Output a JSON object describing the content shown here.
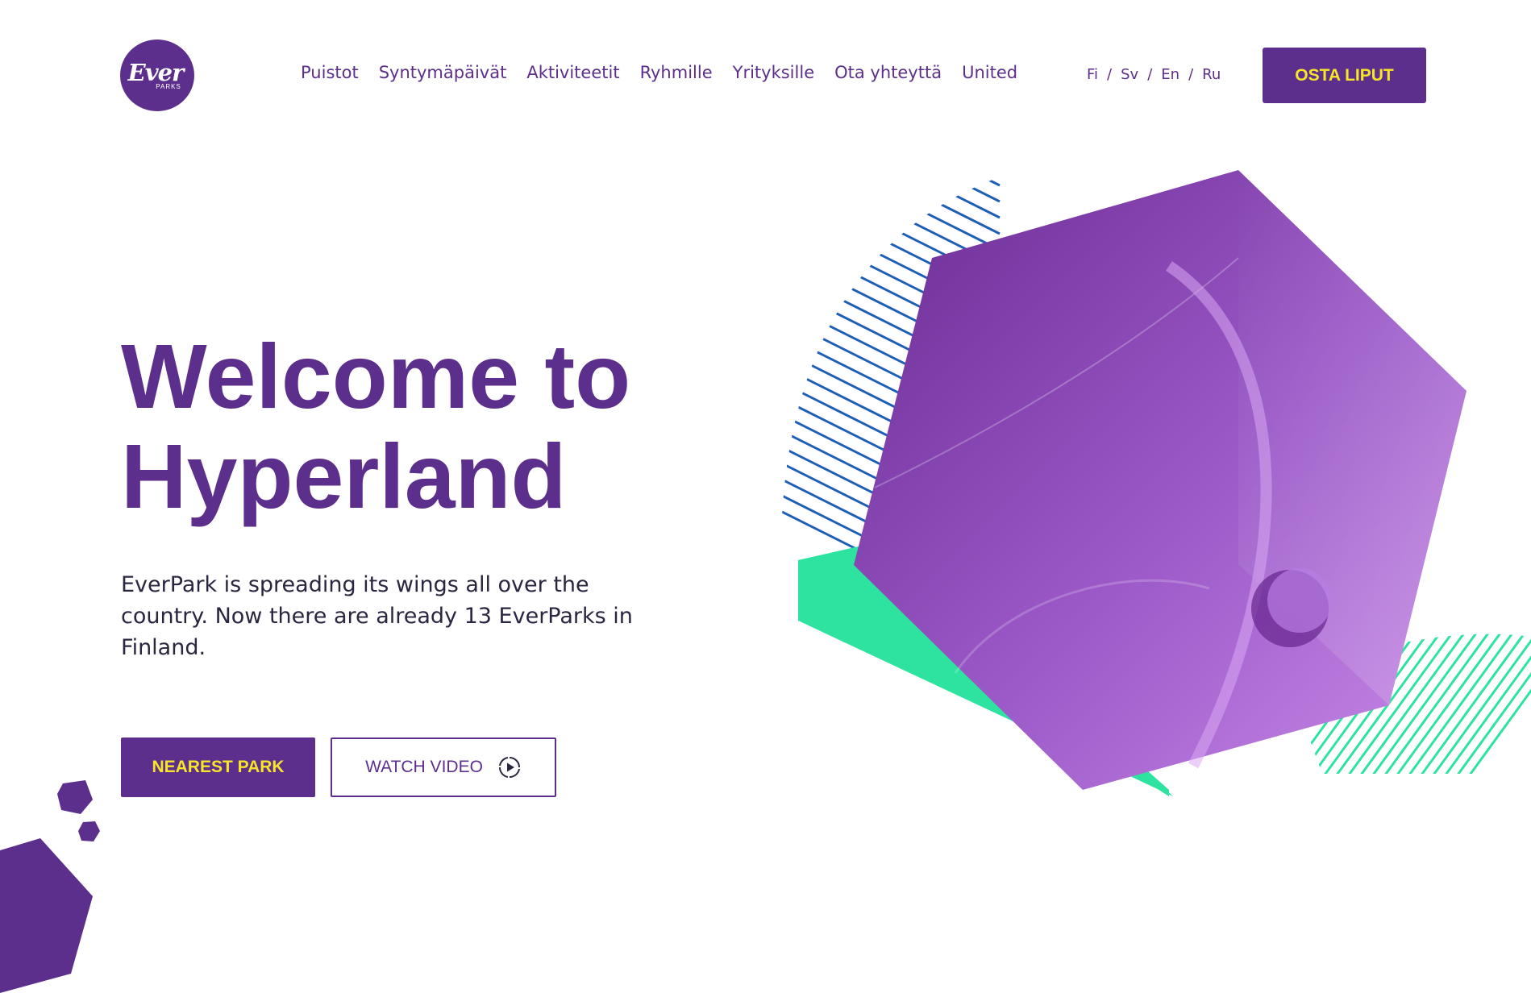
{
  "brand": {
    "logo_word": "Ever",
    "logo_sub": "PARKS"
  },
  "nav": {
    "items": [
      {
        "label": "Puistot"
      },
      {
        "label": "Syntymäpäivät"
      },
      {
        "label": "Aktiviteetit"
      },
      {
        "label": "Ryhmille"
      },
      {
        "label": "Yrityksille"
      },
      {
        "label": "Ota yhteyttä"
      },
      {
        "label": "United"
      }
    ]
  },
  "languages": {
    "items": [
      "Fi",
      "Sv",
      "En",
      "Ru"
    ],
    "separator": "/"
  },
  "header": {
    "buy_label": "OSTA LIPUT"
  },
  "hero": {
    "title_line1": "Welcome to",
    "title_line2": "Hyperland",
    "text": "EverPark is spreading its wings all over the country. Now there are already 13 EverParks in Finland.",
    "nearest_label": "NEAREST PARK",
    "video_label": "WATCH VIDEO"
  },
  "colors": {
    "brand_purple": "#5d2f8d",
    "accent_yellow": "#f7e627",
    "accent_green": "#2ee3a0",
    "stripe_blue": "#1d5fb8"
  },
  "icons": {
    "video": "play-circle-icon"
  }
}
